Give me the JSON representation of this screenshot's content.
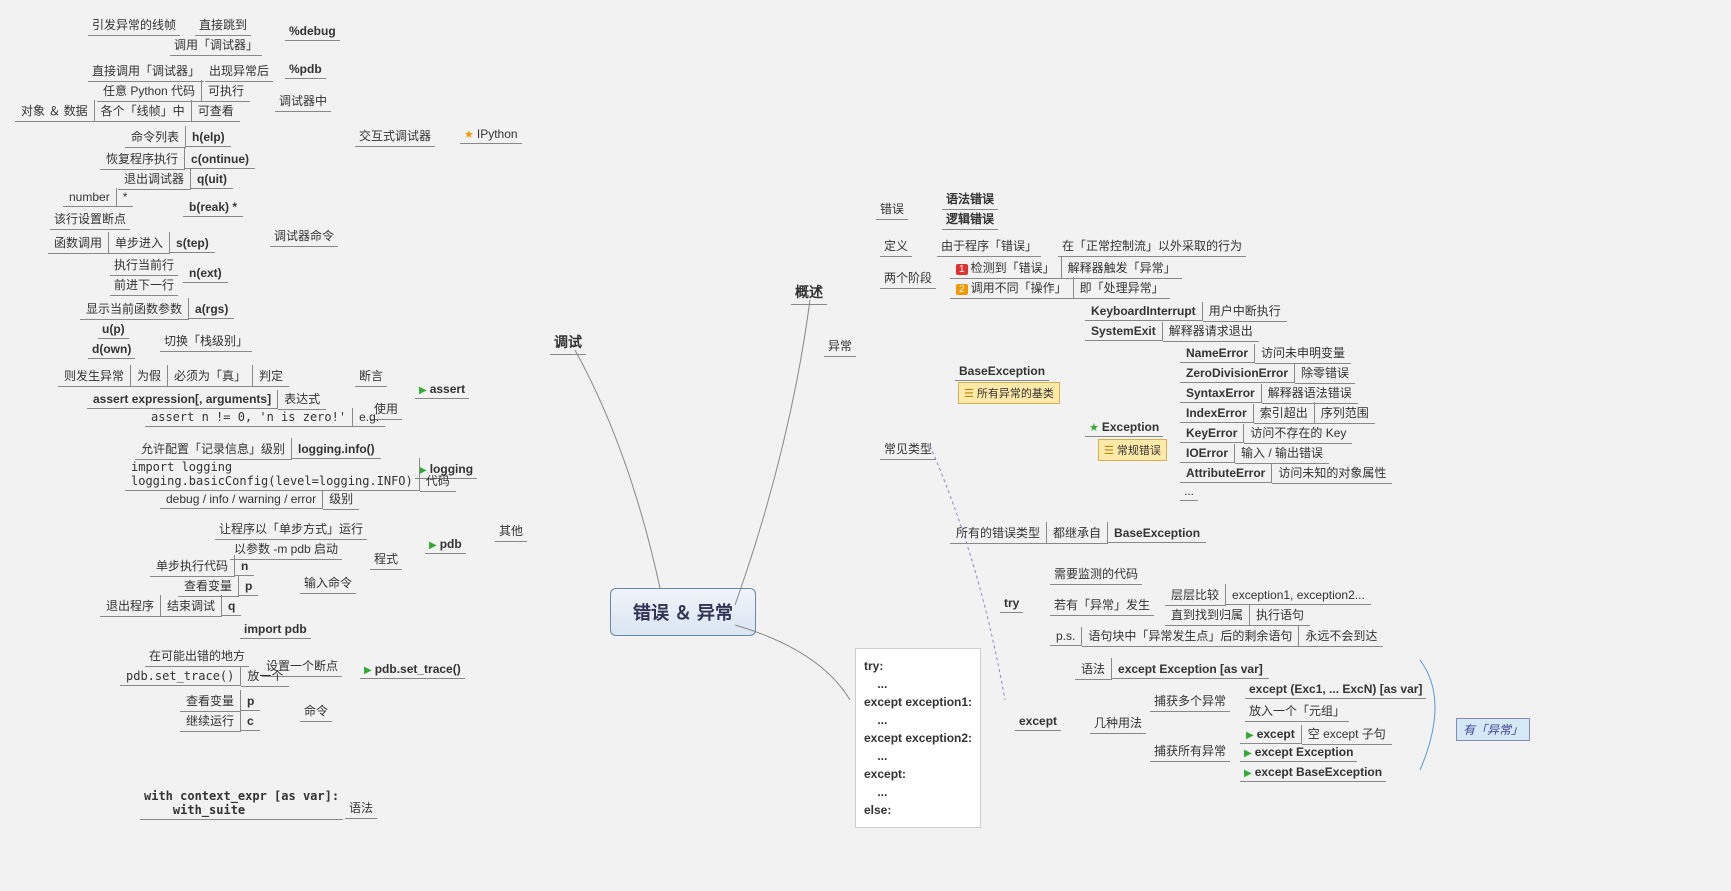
{
  "root": "错误 ＆ 异常",
  "debug": {
    "title": "调试",
    "inter": "交互式调试器",
    "ipy": "IPython",
    "pdebug": {
      "cmd": "%debug",
      "a": "引发异常的线帧",
      "b": "直接跳到",
      "c": "调用「调试器」"
    },
    "ppdb": {
      "cmd": "%pdb",
      "a": "直接调用「调试器」",
      "b": "出现异常后"
    },
    "indbg": {
      "t": "调试器中",
      "r1a": "任意 Python 代码",
      "r1b": "可执行",
      "r2a": "对象 ＆ 数据",
      "r2b": "各个「线帧」中",
      "r2c": "可查看"
    },
    "cmds": {
      "t": "调试器命令",
      "help": {
        "c": "h(elp)",
        "d": "命令列表"
      },
      "cont": {
        "c": "c(ontinue)",
        "d": "恢复程序执行"
      },
      "quit": {
        "c": "q(uit)",
        "d": "退出调试器"
      },
      "brk": {
        "c": "b(reak) *",
        "d1": "number",
        "d2": "*",
        "d3": "该行设置断点"
      },
      "step": {
        "c": "s(tep)",
        "d1": "函数调用",
        "d2": "单步进入"
      },
      "next": {
        "c": "n(ext)",
        "d1": "执行当前行",
        "d2": "前进下一行"
      },
      "args": {
        "c": "a(rgs)",
        "d": "显示当前函数参数"
      },
      "up": {
        "c": "u(p)"
      },
      "down": {
        "c": "d(own)"
      },
      "swlvl": "切换「栈级别」"
    },
    "other": {
      "t": "其他",
      "assert": {
        "t": "assert",
        "use": "使用",
        "judge": "判定",
        "must": "必须为「真」",
        "iffalse": "为假",
        "thenex": "则发生异常",
        "label": "断言",
        "expr": "assert expression[, arguments]",
        "exprl": "表达式",
        "eg": "assert n != 0, 'n is zero!'",
        "egl": "e.g."
      },
      "log": {
        "t": "logging",
        "info": "logging.info()",
        "infod": "允许配置「记录信息」级别",
        "code": "import logging\nlogging.basicConfig(level=logging.INFO)",
        "codel": "代码",
        "lvls": "debug / info / warning / error",
        "lvll": "级别"
      },
      "pdb": {
        "t": "pdb",
        "run": "让程序以「单步方式」运行",
        "mode": "程式",
        "start": "以参数 -m pdb 启动",
        "incmd": "输入命令",
        "n": {
          "c": "n",
          "d": "单步执行代码"
        },
        "p": {
          "c": "p",
          "d": "查看变量"
        },
        "q": {
          "c": "q",
          "d1": "退出程序",
          "d2": "结束调试"
        }
      },
      "settrace": {
        "t": "pdb.set_trace()",
        "imp": "import pdb",
        "bp": "设置一个断点",
        "where": "在可能出错的地方",
        "put": "放一个",
        "putc": "pdb.set_trace()",
        "cmd": "命令",
        "p": {
          "c": "p",
          "d": "查看变量"
        },
        "c": {
          "c": "c",
          "d": "继续运行"
        }
      },
      "with": {
        "syn": "with context_expr [as var]:\n    with_suite",
        "lbl": "语法"
      }
    }
  },
  "ov": {
    "t": "概述",
    "err": {
      "t": "错误",
      "a": "语法错误",
      "b": "逻辑错误"
    },
    "exc": {
      "t": "异常",
      "def": {
        "t": "定义",
        "a": "由于程序「错误」",
        "b": "在「正常控制流」以外采取的行为"
      },
      "two": {
        "t": "两个阶段",
        "r1a": "检测到「错误」",
        "r1b": "解释器触发「异常」",
        "r2a": "调用不同「操作」",
        "r2b": "即「处理异常」"
      },
      "types": {
        "t": "常见类型",
        "base": "BaseException",
        "basen": "所有异常的基类",
        "exception": "Exception",
        "excn": "常规错误",
        "ki": {
          "n": "KeyboardInterrupt",
          "d": "用户中断执行"
        },
        "se": {
          "n": "SystemExit",
          "d": "解释器请求退出"
        },
        "ne": {
          "n": "NameError",
          "d": "访问未申明变量"
        },
        "zd": {
          "n": "ZeroDivisionError",
          "d": "除零错误"
        },
        "sy": {
          "n": "SyntaxError",
          "d": "解释器语法错误"
        },
        "ie": {
          "n": "IndexError",
          "d1": "索引超出",
          "d2": "序列范围"
        },
        "ke": {
          "n": "KeyError",
          "d": "访问不存在的 Key"
        },
        "io": {
          "n": "IOError",
          "d": "输入 / 输出错误"
        },
        "ae": {
          "n": "AttributeError",
          "d": "访问未知的对象属性"
        },
        "etc": "..."
      },
      "all": {
        "a": "所有的错误类型",
        "b": "都继承自",
        "c": "BaseException"
      }
    }
  },
  "tryexc": {
    "syn": "try:\n    ...\nexcept exception1:\n    ...\nexcept exception2:\n    ...\nexcept:\n    ...\nelse:",
    "try": {
      "t": "try",
      "a": "需要监测的代码",
      "b": "若有「异常」发生",
      "b1": "层层比较",
      "b1x": "exception1, exception2...",
      "b2": "直到找到归属",
      "b2x": "执行语句",
      "ps": "p.s.",
      "psa": "语句块中「异常发生点」后的剩余语句",
      "psb": "永远不会到达"
    },
    "except": {
      "t": "except",
      "syn": "语法",
      "synd": "except Exception [as var]",
      "use": "几种用法",
      "multi": {
        "t": "捕获多个异常",
        "a": "except (Exc1, ... ExcN) [as var]",
        "b": "放入一个「元组」"
      },
      "all": {
        "t": "捕获所有异常",
        "a": "except",
        "ad": "空 except 子句",
        "b": "except Exception",
        "c": "except BaseException"
      }
    },
    "has": "有「异常」"
  }
}
